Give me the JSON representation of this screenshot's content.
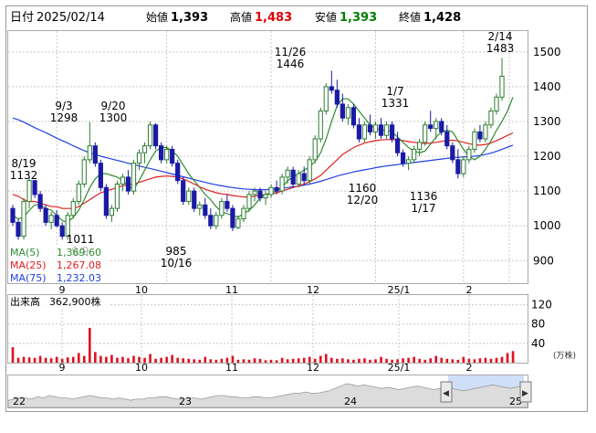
{
  "header": {
    "date_label": "日付",
    "date": "2025/02/14",
    "open_label": "始値",
    "open": "1,393",
    "high_label": "高値",
    "high": "1,483",
    "low_label": "安値",
    "low": "1,393",
    "close_label": "終値",
    "close": "1,428"
  },
  "colors": {
    "up": "#2e7d32",
    "down": "#1a1aa6",
    "high": "#e00000",
    "low": "#008000",
    "ma5": "#2e8b2e",
    "ma25": "#e02020",
    "ma75": "#2040e0",
    "volume": "#e01020",
    "grid": "#c8c8c8",
    "navigator_fill": "#a9c4f2"
  },
  "legend": {
    "ma5_label": "MA(5)",
    "ma5_value": "1,369.60",
    "ma25_label": "MA(25)",
    "ma25_value": "1,267.08",
    "ma75_label": "MA(75)",
    "ma75_value": "1,232.03"
  },
  "volume_panel": {
    "label": "出来高",
    "value": "362,900株",
    "unit": "(万株)",
    "y_ticks": [
      "120",
      "80",
      "40"
    ]
  },
  "navigator": {
    "labels": [
      "22",
      "23",
      "24",
      "25"
    ],
    "left_arrow": "◀",
    "right_arrow": "▶"
  },
  "annotations": [
    {
      "date": "8/19",
      "value": "1132"
    },
    {
      "date": "9/3",
      "value": "1298"
    },
    {
      "date": "9/20",
      "value": "1300"
    },
    {
      "date": "9/9",
      "value": "1011"
    },
    {
      "date": "10/16",
      "value": "985"
    },
    {
      "date": "11/26",
      "value": "1446"
    },
    {
      "date": "1/7",
      "value": "1331"
    },
    {
      "date": "12/20",
      "value": "1160"
    },
    {
      "date": "1/17",
      "value": "1136"
    },
    {
      "date": "2/14",
      "value": "1483"
    }
  ],
  "chart_data": {
    "type": "candlestick",
    "x_tick_labels": [
      "9",
      "10",
      "11",
      "12",
      "25/1",
      "2"
    ],
    "y_ticks": [
      900,
      1000,
      1100,
      1200,
      1300,
      1400,
      1500
    ],
    "ylim": [
      835,
      1560
    ],
    "grid": true,
    "candles": [
      [
        1050,
        1060,
        1000,
        1010
      ],
      [
        1010,
        1020,
        960,
        970
      ],
      [
        970,
        1080,
        960,
        1070
      ],
      [
        1070,
        1140,
        1050,
        1130
      ],
      [
        1130,
        1132,
        1080,
        1090
      ],
      [
        1090,
        1100,
        1040,
        1050
      ],
      [
        1050,
        1060,
        1000,
        1010
      ],
      [
        1010,
        1040,
        990,
        1030
      ],
      [
        1030,
        1045,
        995,
        1000
      ],
      [
        1000,
        1010,
        960,
        970
      ],
      [
        970,
        1040,
        960,
        1030
      ],
      [
        1030,
        1080,
        1020,
        1070
      ],
      [
        1070,
        1130,
        1060,
        1120
      ],
      [
        1120,
        1200,
        1110,
        1190
      ],
      [
        1190,
        1298,
        1180,
        1230
      ],
      [
        1230,
        1240,
        1170,
        1180
      ],
      [
        1180,
        1190,
        1100,
        1110
      ],
      [
        1110,
        1120,
        1020,
        1030
      ],
      [
        1030,
        1060,
        1011,
        1050
      ],
      [
        1050,
        1130,
        1040,
        1120
      ],
      [
        1120,
        1150,
        1100,
        1140
      ],
      [
        1140,
        1160,
        1090,
        1100
      ],
      [
        1100,
        1190,
        1090,
        1180
      ],
      [
        1180,
        1220,
        1160,
        1210
      ],
      [
        1210,
        1240,
        1180,
        1230
      ],
      [
        1230,
        1300,
        1220,
        1290
      ],
      [
        1290,
        1295,
        1220,
        1230
      ],
      [
        1230,
        1240,
        1180,
        1190
      ],
      [
        1190,
        1230,
        1180,
        1220
      ],
      [
        1220,
        1230,
        1170,
        1180
      ],
      [
        1180,
        1190,
        1120,
        1130
      ],
      [
        1130,
        1140,
        1060,
        1070
      ],
      [
        1070,
        1110,
        1060,
        1100
      ],
      [
        1100,
        1110,
        1040,
        1050
      ],
      [
        1050,
        1070,
        1030,
        1060
      ],
      [
        1060,
        1080,
        1020,
        1030
      ],
      [
        1030,
        1050,
        990,
        1000
      ],
      [
        1000,
        1040,
        990,
        1030
      ],
      [
        1030,
        1080,
        1020,
        1070
      ],
      [
        1070,
        1090,
        1040,
        1050
      ],
      [
        1050,
        1060,
        985,
        995
      ],
      [
        995,
        1030,
        990,
        1020
      ],
      [
        1020,
        1060,
        1010,
        1050
      ],
      [
        1050,
        1100,
        1040,
        1090
      ],
      [
        1090,
        1110,
        1070,
        1100
      ],
      [
        1100,
        1110,
        1070,
        1080
      ],
      [
        1080,
        1100,
        1060,
        1090
      ],
      [
        1090,
        1120,
        1080,
        1110
      ],
      [
        1110,
        1130,
        1090,
        1100
      ],
      [
        1100,
        1150,
        1090,
        1140
      ],
      [
        1140,
        1170,
        1120,
        1160
      ],
      [
        1160,
        1170,
        1110,
        1120
      ],
      [
        1120,
        1160,
        1110,
        1150
      ],
      [
        1150,
        1170,
        1120,
        1130
      ],
      [
        1130,
        1200,
        1120,
        1190
      ],
      [
        1190,
        1260,
        1180,
        1250
      ],
      [
        1250,
        1340,
        1240,
        1330
      ],
      [
        1330,
        1410,
        1320,
        1400
      ],
      [
        1400,
        1446,
        1380,
        1390
      ],
      [
        1390,
        1420,
        1340,
        1350
      ],
      [
        1350,
        1380,
        1300,
        1310
      ],
      [
        1310,
        1350,
        1290,
        1340
      ],
      [
        1340,
        1350,
        1280,
        1290
      ],
      [
        1290,
        1310,
        1240,
        1250
      ],
      [
        1250,
        1300,
        1240,
        1290
      ],
      [
        1290,
        1320,
        1260,
        1270
      ],
      [
        1270,
        1300,
        1250,
        1290
      ],
      [
        1290,
        1310,
        1250,
        1260
      ],
      [
        1260,
        1300,
        1250,
        1290
      ],
      [
        1290,
        1300,
        1240,
        1250
      ],
      [
        1250,
        1270,
        1200,
        1210
      ],
      [
        1210,
        1220,
        1170,
        1180
      ],
      [
        1180,
        1200,
        1160,
        1190
      ],
      [
        1190,
        1230,
        1180,
        1220
      ],
      [
        1220,
        1250,
        1200,
        1240
      ],
      [
        1240,
        1300,
        1230,
        1290
      ],
      [
        1290,
        1331,
        1270,
        1280
      ],
      [
        1280,
        1310,
        1250,
        1300
      ],
      [
        1300,
        1310,
        1260,
        1270
      ],
      [
        1270,
        1290,
        1220,
        1230
      ],
      [
        1230,
        1240,
        1180,
        1190
      ],
      [
        1190,
        1220,
        1136,
        1150
      ],
      [
        1150,
        1200,
        1140,
        1190
      ],
      [
        1190,
        1230,
        1180,
        1220
      ],
      [
        1220,
        1280,
        1210,
        1270
      ],
      [
        1270,
        1290,
        1240,
        1250
      ],
      [
        1250,
        1300,
        1240,
        1290
      ],
      [
        1290,
        1340,
        1280,
        1330
      ],
      [
        1330,
        1380,
        1320,
        1370
      ],
      [
        1370,
        1483,
        1360,
        1430
      ]
    ],
    "ma5": [
      1030,
      1020,
      1025,
      1045,
      1060,
      1060,
      1050,
      1045,
      1030,
      1015,
      1010,
      1025,
      1045,
      1075,
      1110,
      1135,
      1150,
      1150,
      1145,
      1140,
      1130,
      1115,
      1105,
      1130,
      1160,
      1190,
      1215,
      1225,
      1225,
      1215,
      1200,
      1175,
      1150,
      1130,
      1110,
      1090,
      1075,
      1055,
      1040,
      1035,
      1030,
      1025,
      1035,
      1045,
      1060,
      1080,
      1090,
      1095,
      1100,
      1110,
      1130,
      1140,
      1150,
      1160,
      1170,
      1185,
      1210,
      1250,
      1300,
      1345,
      1365,
      1365,
      1350,
      1330,
      1310,
      1290,
      1280,
      1275,
      1275,
      1270,
      1255,
      1240,
      1225,
      1215,
      1210,
      1215,
      1235,
      1255,
      1270,
      1275,
      1270,
      1245,
      1220,
      1200,
      1190,
      1200,
      1220,
      1245,
      1275,
      1300,
      1330,
      1370
    ],
    "ma25": [
      1090,
      1085,
      1075,
      1070,
      1070,
      1065,
      1060,
      1055,
      1055,
      1050,
      1050,
      1050,
      1055,
      1065,
      1075,
      1085,
      1095,
      1100,
      1105,
      1110,
      1115,
      1118,
      1120,
      1125,
      1130,
      1135,
      1140,
      1142,
      1143,
      1142,
      1140,
      1135,
      1128,
      1120,
      1112,
      1105,
      1100,
      1095,
      1092,
      1090,
      1087,
      1085,
      1083,
      1083,
      1085,
      1088,
      1090,
      1092,
      1095,
      1100,
      1105,
      1110,
      1115,
      1120,
      1127,
      1135,
      1145,
      1160,
      1175,
      1190,
      1205,
      1215,
      1225,
      1232,
      1238,
      1242,
      1245,
      1247,
      1248,
      1248,
      1247,
      1245,
      1242,
      1240,
      1238,
      1237,
      1238,
      1240,
      1243,
      1245,
      1246,
      1244,
      1240,
      1236,
      1233,
      1232,
      1234,
      1238,
      1245,
      1252,
      1260,
      1267
    ],
    "ma75": [
      1310,
      1305,
      1298,
      1290,
      1282,
      1275,
      1268,
      1260,
      1252,
      1245,
      1238,
      1230,
      1223,
      1216,
      1210,
      1205,
      1200,
      1196,
      1192,
      1188,
      1184,
      1180,
      1176,
      1172,
      1168,
      1165,
      1161,
      1157,
      1153,
      1149,
      1145,
      1141,
      1137,
      1133,
      1129,
      1125,
      1121,
      1118,
      1115,
      1112,
      1110,
      1108,
      1106,
      1105,
      1104,
      1104,
      1104,
      1105,
      1106,
      1108,
      1110,
      1112,
      1114,
      1117,
      1120,
      1124,
      1128,
      1133,
      1138,
      1143,
      1147,
      1151,
      1155,
      1158,
      1161,
      1164,
      1167,
      1170,
      1172,
      1174,
      1176,
      1178,
      1180,
      1182,
      1184,
      1186,
      1188,
      1190,
      1192,
      1194,
      1196,
      1197,
      1198,
      1199,
      1200,
      1202,
      1205,
      1209,
      1214,
      1220,
      1226,
      1232
    ],
    "volume": [
      32,
      10,
      12,
      11,
      10,
      14,
      10,
      9,
      12,
      8,
      11,
      12,
      20,
      14,
      72,
      22,
      14,
      12,
      16,
      10,
      12,
      9,
      14,
      12,
      10,
      18,
      8,
      10,
      12,
      16,
      10,
      9,
      8,
      7,
      6,
      12,
      7,
      6,
      8,
      10,
      14,
      6,
      7,
      6,
      9,
      8,
      5,
      6,
      5,
      10,
      7,
      8,
      9,
      10,
      12,
      8,
      14,
      18,
      10,
      8,
      9,
      7,
      6,
      8,
      9,
      6,
      7,
      12,
      8,
      6,
      7,
      9,
      10,
      12,
      8,
      6,
      9,
      14,
      10,
      8,
      7,
      6,
      12,
      8,
      7,
      9,
      10,
      8,
      10,
      12,
      20,
      24
    ],
    "navigator_series": [
      20,
      21,
      22,
      22,
      21,
      23,
      22,
      24,
      23,
      22,
      22,
      21,
      22,
      23,
      24,
      23,
      22,
      22,
      21,
      22,
      21,
      20,
      21,
      21,
      22,
      22,
      23,
      23,
      22,
      21,
      21,
      22,
      22,
      21,
      22,
      23,
      24,
      24,
      23,
      23,
      22,
      22,
      23,
      23,
      22,
      22,
      23,
      24,
      25,
      26,
      26,
      27,
      26,
      26,
      27,
      28,
      30,
      32,
      34,
      33,
      32,
      33,
      32,
      31,
      30,
      31,
      30,
      29,
      30,
      31,
      32,
      31,
      30,
      29,
      30,
      31,
      30,
      29,
      28,
      29,
      30,
      31,
      32,
      33,
      32,
      31,
      30,
      31,
      32,
      30
    ]
  }
}
